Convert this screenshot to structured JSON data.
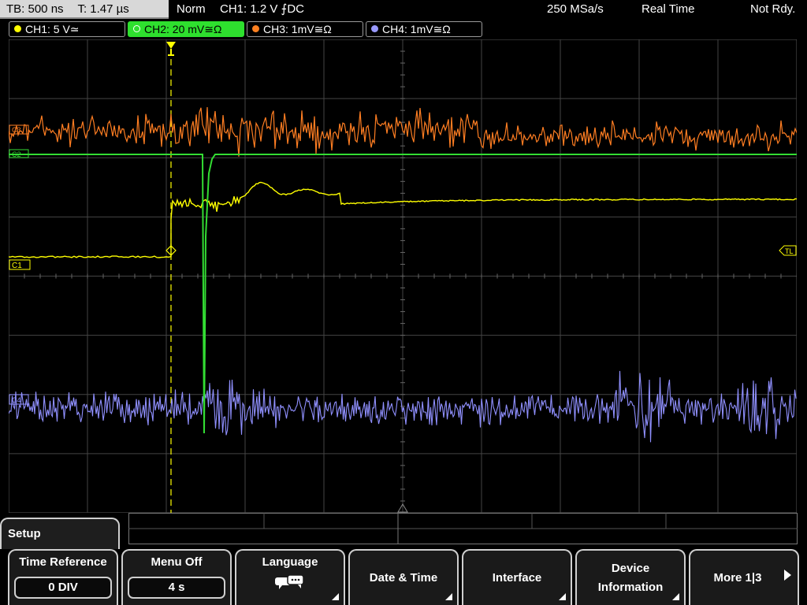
{
  "topbar": {
    "timebase": "TB: 500 ns",
    "trigger_pos": "T: 1.47 µs",
    "trigger_mode": "Norm",
    "trigger_info": "CH1: 1.2 V ⨍DC",
    "sample_rate": "250 MSa/s",
    "acq_mode": "Real Time",
    "status": "Not Rdy."
  },
  "channels": [
    {
      "label": "CH1: 5 V≃",
      "color": "#ffff00"
    },
    {
      "label": "CH2: 20 mV≅Ω",
      "color": "#33dd33"
    },
    {
      "label": "CH3: 1mV≅Ω",
      "color": "#ff8020"
    },
    {
      "label": "CH4: 1mV≅Ω",
      "color": "#9a9aff"
    }
  ],
  "markers": {
    "c1": "C1",
    "tl": "TL",
    "c2": "C2",
    "c3": "C3",
    "c4": "C4"
  },
  "menu": {
    "title": "Setup",
    "buttons": [
      {
        "label": "Time Reference",
        "value": "0 DIV"
      },
      {
        "label": "Menu Off",
        "value": "4 s"
      },
      {
        "label": "Language",
        "icon": "speech-bubbles-icon"
      },
      {
        "label": "Date & Time"
      },
      {
        "label": "Interface"
      },
      {
        "label": "Device Information"
      },
      {
        "label": "More 1|3"
      }
    ]
  }
}
